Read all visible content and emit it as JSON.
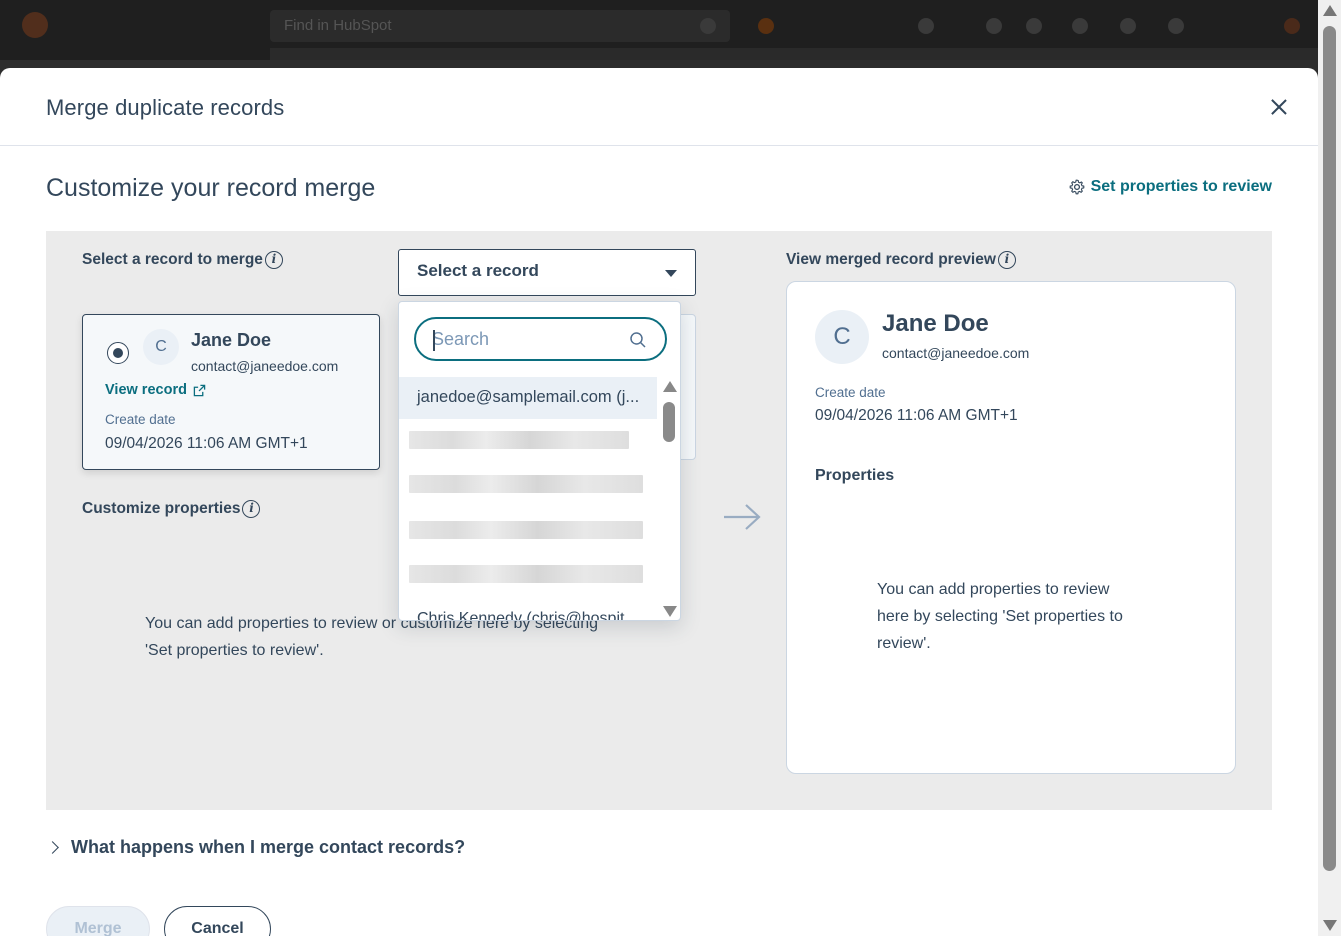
{
  "app": {
    "search_placeholder": "Find in HubSpot"
  },
  "modal": {
    "title": "Merge duplicate records",
    "close_label": "Close",
    "subtitle": "Customize your record merge",
    "set_properties_link": "Set properties to review"
  },
  "left": {
    "select_label": "Select a record to merge",
    "record": {
      "avatar_initial": "C",
      "name": "Jane Doe",
      "email": "contact@janeedoe.com",
      "view_link": "View record",
      "create_date_label": "Create date",
      "create_date_value": "09/04/2026 11:06 AM GMT+1"
    },
    "customize_label": "Customize properties",
    "empty_text_line1": "You can add properties to review or customize here by selecting",
    "empty_text_line2": "'Set properties to review'."
  },
  "select": {
    "label": "Select a record",
    "search_placeholder": "Search",
    "search_value": "",
    "options": [
      "janedoe@samplemail.com (j...",
      "Chris Kennedy (chris@hospit..."
    ]
  },
  "preview": {
    "label": "View merged record preview",
    "avatar_initial": "C",
    "name": "Jane Doe",
    "email": "contact@janeedoe.com",
    "create_date_label": "Create date",
    "create_date_value": "09/04/2026 11:06 AM GMT+1",
    "properties_label": "Properties",
    "empty_line1": "You can add properties to review",
    "empty_line2": "here by selecting 'Set properties to",
    "empty_line3": "review'."
  },
  "faq": {
    "label": "What happens when I merge contact records?"
  },
  "footer": {
    "merge_label": "Merge",
    "cancel_label": "Cancel"
  },
  "colors": {
    "accent": "#0b6e7f",
    "text": "#33475b",
    "panel": "#ebebeb"
  }
}
